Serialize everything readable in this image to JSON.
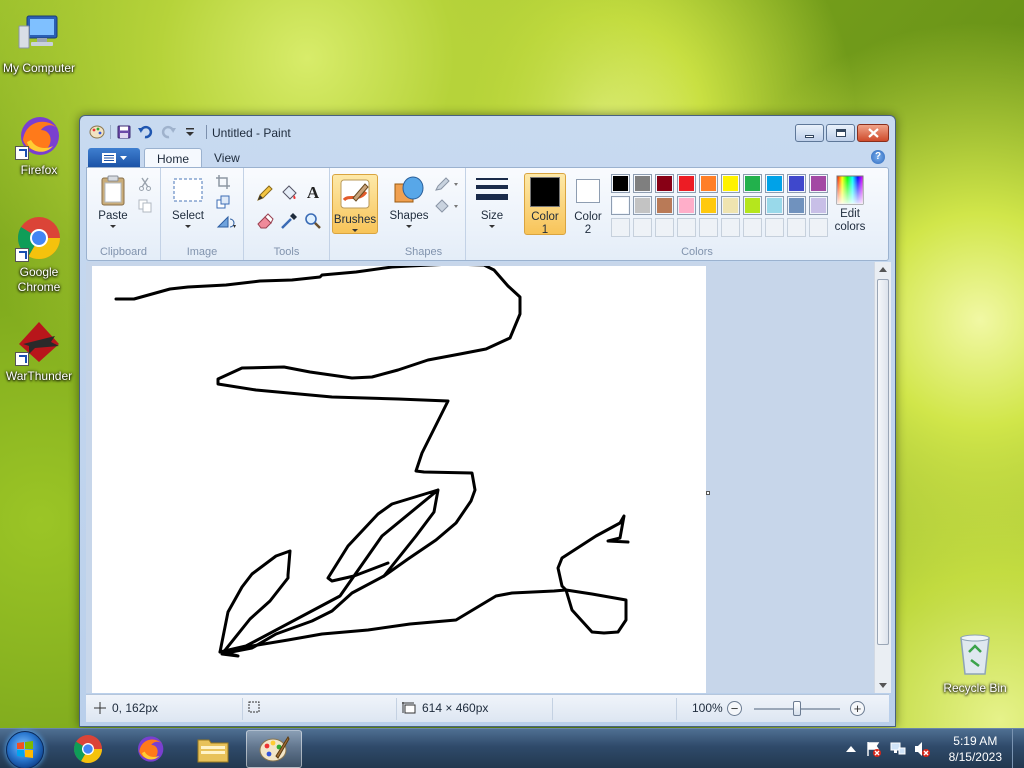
{
  "desktop": {
    "icons": [
      {
        "label": "My Computer",
        "icon": "computer-icon"
      },
      {
        "label": "Firefox",
        "icon": "firefox-icon"
      },
      {
        "label": "Google Chrome",
        "icon": "chrome-icon"
      },
      {
        "label": "WarThunder",
        "icon": "warthunder-icon"
      },
      {
        "label": "Recycle Bin",
        "icon": "recycle-bin-icon"
      }
    ]
  },
  "window": {
    "title": "Untitled - Paint",
    "tabs": [
      {
        "label": "Home",
        "active": true
      },
      {
        "label": "View",
        "active": false
      }
    ],
    "ribbon": {
      "clipboard": {
        "group_label": "Clipboard",
        "paste_label": "Paste"
      },
      "image": {
        "group_label": "Image",
        "select_label": "Select"
      },
      "tools": {
        "group_label": "Tools"
      },
      "brushes": {
        "label": "Brushes"
      },
      "shapes": {
        "group_label": "Shapes",
        "shapes_label": "Shapes"
      },
      "size": {
        "label": "Size"
      },
      "colors": {
        "group_label": "Colors",
        "color1_label": "Color",
        "color1_num": "1",
        "color2_label": "Color",
        "color2_num": "2",
        "edit_label_1": "Edit",
        "edit_label_2": "colors",
        "color1_value": "#000000",
        "color2_value": "#ffffff",
        "palette_row1": [
          "#000000",
          "#7f7f7f",
          "#880015",
          "#ed1c24",
          "#ff7f27",
          "#fff200",
          "#22b14c",
          "#00a2e8",
          "#3f48cc",
          "#a349a4"
        ],
        "palette_row2": [
          "#ffffff",
          "#c3c3c3",
          "#b97a57",
          "#ffaec9",
          "#ffc90e",
          "#efe4b0",
          "#b5e61d",
          "#99d9ea",
          "#7092be",
          "#c8bfe7"
        ]
      }
    },
    "status": {
      "cursor_pos": "0, 162px",
      "selection_size": "",
      "canvas_size": "614 × 460px",
      "zoom": "100%",
      "zoom_minus": "−",
      "zoom_plus": "+"
    }
  },
  "taskbar": {
    "items": [
      {
        "icon": "chrome-icon"
      },
      {
        "icon": "firefox-icon"
      },
      {
        "icon": "file-explorer-icon"
      },
      {
        "icon": "paint-icon",
        "active": true
      }
    ],
    "clock_time": "5:19 AM",
    "clock_date": "8/15/2023"
  }
}
